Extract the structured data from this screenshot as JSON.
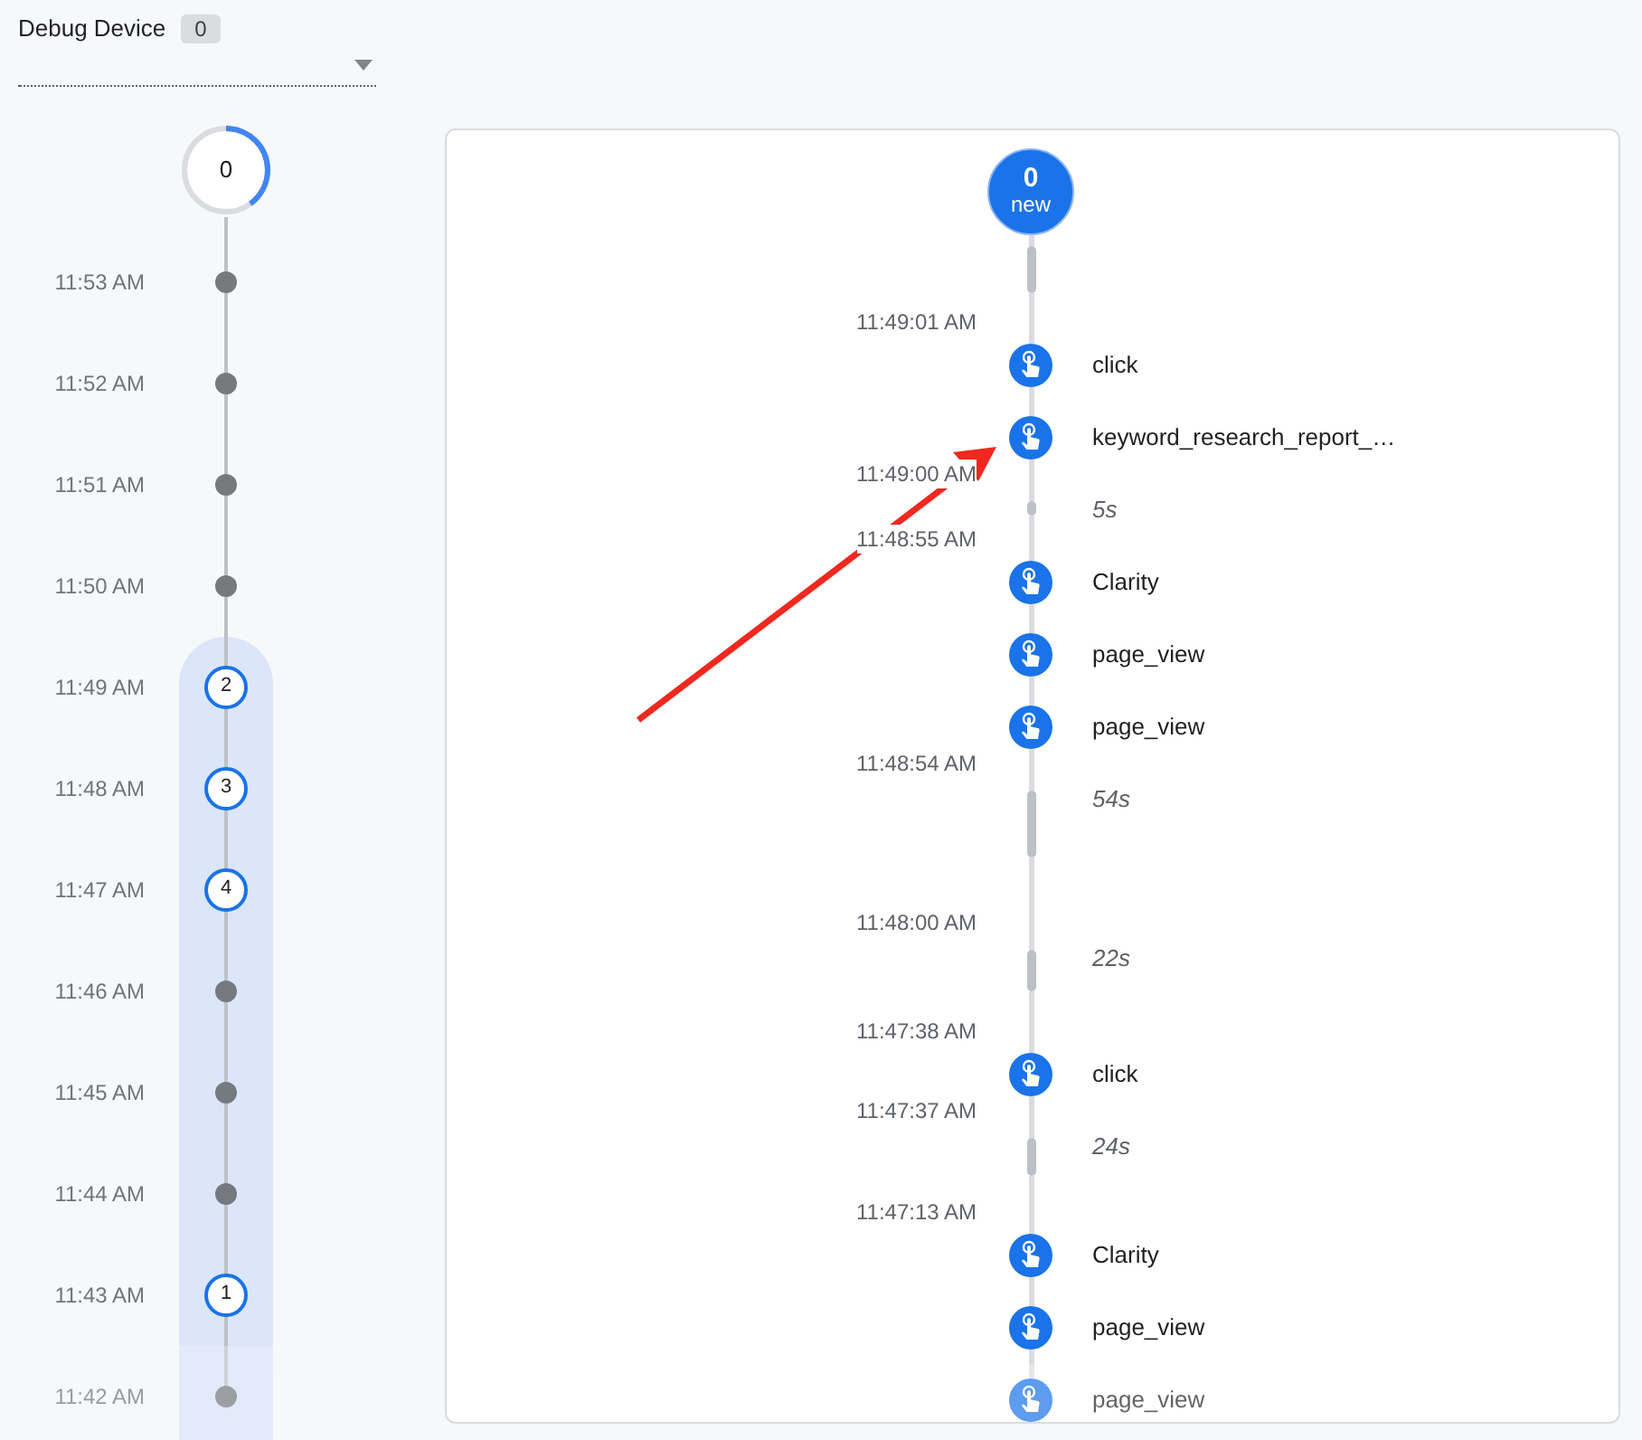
{
  "device": {
    "label": "Debug Device",
    "count": "0"
  },
  "minutes_timeline": {
    "top": {
      "count": "0",
      "level": 0.4
    },
    "items": [
      {
        "time": "11:53 AM",
        "kind": "dot",
        "highlighted": false
      },
      {
        "time": "11:52 AM",
        "kind": "dot",
        "highlighted": false
      },
      {
        "time": "11:51 AM",
        "kind": "dot",
        "highlighted": false
      },
      {
        "time": "11:50 AM",
        "kind": "dot",
        "highlighted": false
      },
      {
        "time": "11:49 AM",
        "kind": "count",
        "count": "2",
        "highlighted": true
      },
      {
        "time": "11:48 AM",
        "kind": "count",
        "count": "3",
        "highlighted": true
      },
      {
        "time": "11:47 AM",
        "kind": "count",
        "count": "4",
        "highlighted": true
      },
      {
        "time": "11:46 AM",
        "kind": "dot",
        "highlighted": true
      },
      {
        "time": "11:45 AM",
        "kind": "dot",
        "highlighted": true
      },
      {
        "time": "11:44 AM",
        "kind": "dot",
        "highlighted": true
      },
      {
        "time": "11:43 AM",
        "kind": "count",
        "count": "1",
        "highlighted": true
      },
      {
        "time": "11:42 AM",
        "kind": "dot",
        "highlighted": true
      }
    ]
  },
  "seconds_timeline": {
    "new_badge": {
      "count": "0",
      "label": "new"
    },
    "items": [
      {
        "kind": "time",
        "text": "11:49:01 AM"
      },
      {
        "kind": "event",
        "text": "click"
      },
      {
        "kind": "event",
        "text": "keyword_research_report_…"
      },
      {
        "kind": "time",
        "text": "11:49:00 AM"
      },
      {
        "kind": "gap",
        "text": "5s"
      },
      {
        "kind": "time",
        "text": "11:48:55 AM"
      },
      {
        "kind": "event",
        "text": "Clarity"
      },
      {
        "kind": "event",
        "text": "page_view"
      },
      {
        "kind": "event",
        "text": "page_view"
      },
      {
        "kind": "time",
        "text": "11:48:54 AM"
      },
      {
        "kind": "gap",
        "text": "54s"
      },
      {
        "kind": "time",
        "text": "11:48:00 AM"
      },
      {
        "kind": "gap",
        "text": "22s"
      },
      {
        "kind": "time",
        "text": "11:47:38 AM"
      },
      {
        "kind": "event",
        "text": "click"
      },
      {
        "kind": "time",
        "text": "11:47:37 AM"
      },
      {
        "kind": "gap",
        "text": "24s"
      },
      {
        "kind": "time",
        "text": "11:47:13 AM"
      },
      {
        "kind": "event",
        "text": "Clarity"
      },
      {
        "kind": "event",
        "text": "page_view"
      },
      {
        "kind": "event",
        "text": "page_view"
      }
    ]
  }
}
